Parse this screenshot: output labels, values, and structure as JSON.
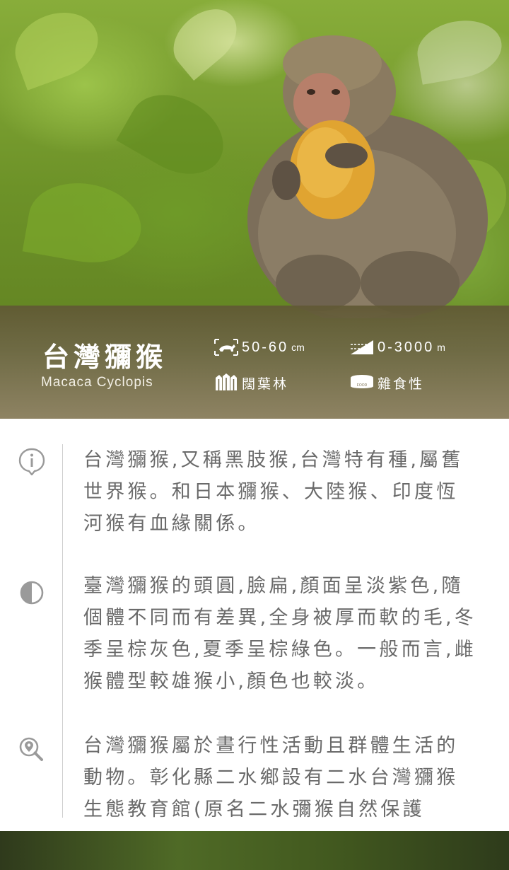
{
  "hero": {
    "image": "Taiwan macaque eating a yellow fruit among green foliage",
    "title_zh": "台灣獼猴",
    "title_en": "Macaca Cyclopis",
    "stats": {
      "size": {
        "icon": "monkey-size-icon",
        "value": "50-60",
        "unit": "cm"
      },
      "altitude": {
        "icon": "altitude-icon",
        "value": "0-3000",
        "unit": "m"
      },
      "habitat": {
        "icon": "forest-icon",
        "label": "闊葉林"
      },
      "diet": {
        "icon": "food-bowl-icon",
        "label": "雜食性",
        "icon_text": "FOOD"
      }
    }
  },
  "sections": [
    {
      "icon": "info-icon",
      "text": "台灣獼猴,又稱黑肢猴,台灣特有種,屬舊世界猴。和日本獼猴、大陸猴、印度恆河猴有血緣關係。"
    },
    {
      "icon": "contrast-icon",
      "text": "臺灣獼猴的頭圓,臉扁,顏面呈淡紫色,隨個體不同而有差異,全身被厚而軟的毛,冬季呈棕灰色,夏季呈棕綠色。一般而言,雌猴體型較雄猴小,顏色也較淡。"
    },
    {
      "icon": "location-search-icon",
      "text": "台灣獼猴屬於晝行性活動且群體生活的動物。彰化縣二水鄉設有二水台灣獼猴生態教育館(原名二水彌猴自然保護"
    }
  ],
  "colors": {
    "title_text": "#ffffff",
    "body_text": "#6a6a6a",
    "icon_gray": "#9a9a9a",
    "divider": "#cfcfcf"
  }
}
